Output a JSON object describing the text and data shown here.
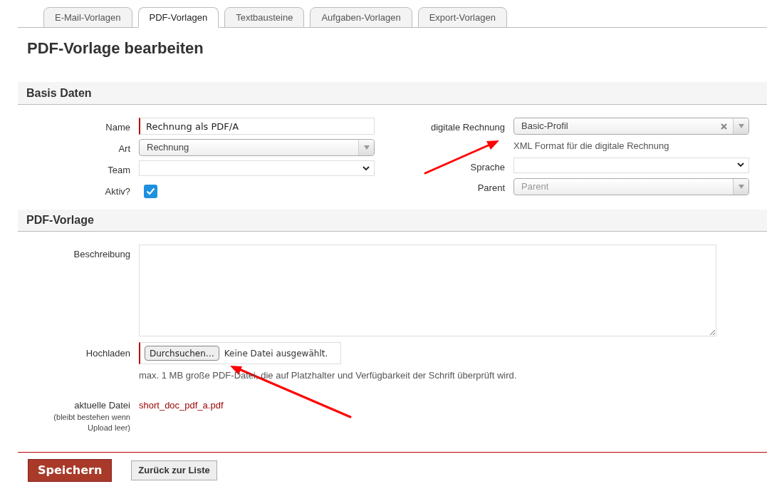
{
  "tabs": [
    {
      "label": "E-Mail-Vorlagen",
      "selected": false
    },
    {
      "label": "PDF-Vorlagen",
      "selected": true
    },
    {
      "label": "Textbausteine",
      "selected": false
    },
    {
      "label": "Aufgaben-Vorlagen",
      "selected": false
    },
    {
      "label": "Export-Vorlagen",
      "selected": false
    }
  ],
  "title": "PDF-Vorlage bearbeiten",
  "basis": {
    "heading": "Basis Daten",
    "left": [
      {
        "kind": "text",
        "label": "Name",
        "value": "Rechnung als PDF/A",
        "required": true
      },
      {
        "kind": "combo",
        "label": "Art",
        "value": "Rechnung"
      },
      {
        "kind": "select",
        "label": "Team"
      },
      {
        "kind": "checkbox",
        "label": "Aktiv?",
        "checked": true
      }
    ],
    "right": [
      {
        "kind": "combo",
        "label": "digitale Rechnung",
        "value": "Basic-Profil",
        "clearable": true,
        "help": "XML Format für die digitale Rechnung"
      },
      {
        "kind": "select",
        "label": "Sprache"
      },
      {
        "kind": "combo",
        "label": "Parent",
        "placeholder": "Parent"
      }
    ]
  },
  "pdf": {
    "heading": "PDF-Vorlage",
    "description_label": "Beschreibung",
    "upload_label": "Hochladen",
    "browse_button": "Durchsuchen…",
    "no_file": "Keine Datei ausgewählt.",
    "upload_help": "max. 1 MB große PDF-Datei, die auf Platzhalter und Verfügbarkeit der Schrift überprüft wird.",
    "current_label": "aktuelle Datei",
    "current_note": "(bleibt bestehen wenn Upload leer)",
    "current_file": "short_doc_pdf_a.pdf"
  },
  "buttons": [
    {
      "kind": "primary",
      "label": "Speichern"
    },
    {
      "kind": "secondary",
      "label": "Zurück zur Liste"
    }
  ]
}
